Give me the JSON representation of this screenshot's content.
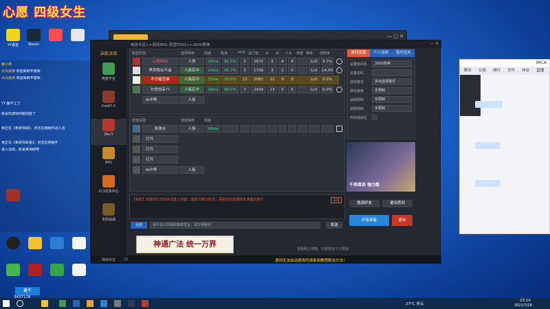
{
  "overlay": {
    "title": "心愿 四级女生"
  },
  "desktop_icons": [
    "YY语音",
    "Steam",
    "",
    "",
    "",
    "",
    "",
    "",
    "",
    "",
    "",
    "",
    "",
    "",
    "",
    "",
    "",
    "",
    "",
    "",
    "",
    "",
    "",
    "",
    "",
    ""
  ],
  "chat": {
    "lines": [
      {
        "name": "鹿小窝",
        "text": ""
      },
      {
        "name": "大白黑骑",
        "text": "欢迎来到丰富频"
      },
      {
        "name": "大白黑骑",
        "text": "欢迎来到丰富频"
      },
      {
        "name": "",
        "text": "YY 都不上了"
      },
      {
        "name": "",
        "text": "就喜欢游戏你能完胜了"
      },
      {
        "name": "",
        "text": "我正在【免费领取】，点击右侧组件进入活"
      },
      {
        "name": "",
        "text": "我正在【免费领取金】，点击右侧组件"
      },
      {
        "name": "",
        "text": "进入活动，赶紧来领取吧"
      }
    ]
  },
  "app": {
    "logo": "启航对战",
    "breadcrumb": "电信专区>>测试RPG-军团TD01>>2600男神",
    "tabs": [
      "游戏设置",
      "个人战绩",
      "我的道具"
    ],
    "side_nav": [
      {
        "label": "竞技平台"
      },
      {
        "label": "DotA7.0"
      },
      {
        "label": "War3"
      },
      {
        "label": "RPG"
      },
      {
        "label": "211任务中心"
      },
      {
        "label": "全民站战"
      }
    ],
    "team1": {
      "title": "联盟军团",
      "headers": [
        "选择种族",
        "网速",
        "胜率",
        "MVP",
        "战力值",
        "木",
        "兵",
        "人头",
        "英雄",
        "等级",
        "逃跑率"
      ],
      "rows": [
        {
          "name": "心愿四级",
          "race": "人类",
          "ping": "20ms",
          "win": "81.5%",
          "mvp": "7",
          "power": "2672",
          "wood": "1",
          "army": "4",
          "kill": "4",
          "level": "Lv5",
          "escape": "3.7%"
        },
        {
          "name": "黑洞我似不遥",
          "race": "人族后中",
          "ping": "24ms",
          "win": "85.7%",
          "mvp": "3",
          "power": "1736",
          "wood": "3",
          "army": "1",
          "kill": "0",
          "level": "Lv5",
          "escape": "14.3%"
        },
        {
          "name": "不识者苦谁",
          "race": "人族后中",
          "ping": "35ms",
          "win": "89.6%",
          "mvp": "12",
          "power": "2082",
          "wood": "11",
          "army": "9",
          "kill": "8",
          "level": "Lv5",
          "escape": "0.0%"
        },
        {
          "name": "勿悦他高71",
          "race": "人族后中",
          "ping": "26ms",
          "win": "80.0%",
          "mvp": "7",
          "power": "2429",
          "wood": "13",
          "army": "5",
          "kill": "5",
          "level": "Lv5",
          "escape": "0.0%"
        },
        {
          "name": "AI中等",
          "race": "人族",
          "ping": "",
          "win": "",
          "mvp": "",
          "power": "",
          "wood": "",
          "army": "",
          "kill": "",
          "level": "",
          "escape": ""
        }
      ]
    },
    "team2": {
      "title": "部落军团",
      "headers": [
        "选择种族",
        "网速"
      ],
      "rows": [
        {
          "name": "和漁水",
          "race": "人族",
          "ping": "30ms"
        },
        {
          "name": "打开",
          "race": "",
          "ping": ""
        },
        {
          "name": "打开",
          "race": "",
          "ping": ""
        },
        {
          "name": "打开",
          "race": "",
          "ping": ""
        },
        {
          "name": "AI中等",
          "race": "人族",
          "ping": ""
        }
      ]
    },
    "settings": [
      {
        "label": "设置房间名",
        "value": "2600男神"
      },
      {
        "label": "设置密码",
        "value": ""
      },
      {
        "label": "游戏模式",
        "value": "多动选择模式"
      },
      {
        "label": "游戏速度",
        "value": "无限制"
      },
      {
        "label": "战绩限制",
        "value": "无限制"
      },
      {
        "label": "逃跑限制",
        "value": "无限制"
      },
      {
        "label": "开启观战位",
        "value": ""
      }
    ],
    "ad_text": "千场首杀 强力数",
    "system_msg": "【系统】本房间已开启由设置入功能，进度间满10秒后，系统将自动踢除未准备的用户。",
    "system_tag": "提醒",
    "chat_placeholder": "请不在公共场所随意发言，请文明聊天",
    "chat_target": "全部",
    "send": "发送",
    "invite": "邀请好友",
    "exit": "退出房间",
    "ready": "开始准备",
    "quit": "退出",
    "footer_left": "网络状态",
    "footer_count": "23",
    "footer_hint": "观看网上攻略，已经有多少人观战",
    "banner_text": "神通广法 统一万界",
    "notice": "遇到无法启动游戏时请参阅教程解决方法！",
    "version": "版本号:1.0"
  },
  "right_window": {
    "title": "IMCA",
    "tabs": [
      "聊天",
      "公告",
      "排行",
      "文件",
      "作业",
      "直播"
    ]
  },
  "taskbar": {
    "weather": "27°C 多云",
    "time": "23:10",
    "date": "2021/7/28",
    "overlay_text": "黄牛",
    "overlay_num": "3437178"
  }
}
